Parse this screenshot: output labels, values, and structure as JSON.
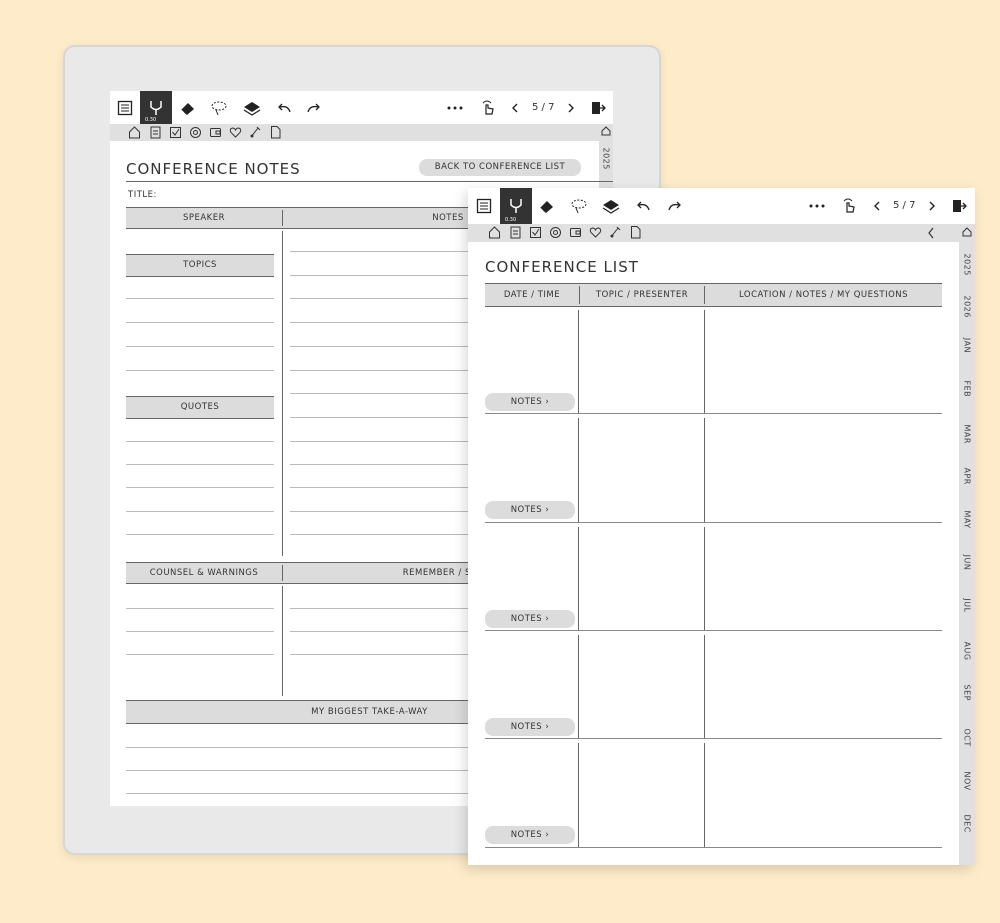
{
  "colors": {
    "background": "#fdebc9",
    "toolbar_active": "#333333",
    "header_fill": "#dcdcdc"
  },
  "device_toolbar": {
    "pen_size": "0.30",
    "page_indicator": "5 / 7",
    "icons": [
      "toc-icon",
      "pen-icon",
      "eraser-icon",
      "lasso-icon",
      "layers-icon",
      "undo-icon",
      "redo-icon",
      "more-icon",
      "touch-icon",
      "prev-page-icon",
      "next-page-icon",
      "exit-icon"
    ]
  },
  "quick_icons": [
    "home-icon",
    "clipboard-icon",
    "checkbox-icon",
    "target-icon",
    "wallet-icon",
    "heart-icon",
    "brush-icon",
    "document-icon"
  ],
  "notes_page": {
    "title": "CONFERENCE NOTES",
    "back_button": "BACK TO CONFERENCE LIST",
    "title_label": "TITLE:",
    "speaker_header": "SPEAKER",
    "notes_header": "NOTES",
    "topics_header": "TOPICS",
    "quotes_header": "QUOTES",
    "counsel_header": "COUNSEL & WARNINGS",
    "remember_header": "REMEMBER / SUMM",
    "takeaway_header": "MY BIGGEST TAKE-A-WAY",
    "year_tab": "2025"
  },
  "list_page": {
    "title": "CONFERENCE LIST",
    "columns": [
      "DATE / TIME",
      "TOPIC / PRESENTER",
      "LOCATION / NOTES / MY QUESTIONS"
    ],
    "notes_button": "NOTES",
    "rows": 5,
    "side_tabs": [
      "2025",
      "2026",
      "JAN",
      "FEB",
      "MAR",
      "APR",
      "MAY",
      "JUN",
      "JUL",
      "AUG",
      "SEP",
      "OCT",
      "NOV",
      "DEC"
    ]
  }
}
